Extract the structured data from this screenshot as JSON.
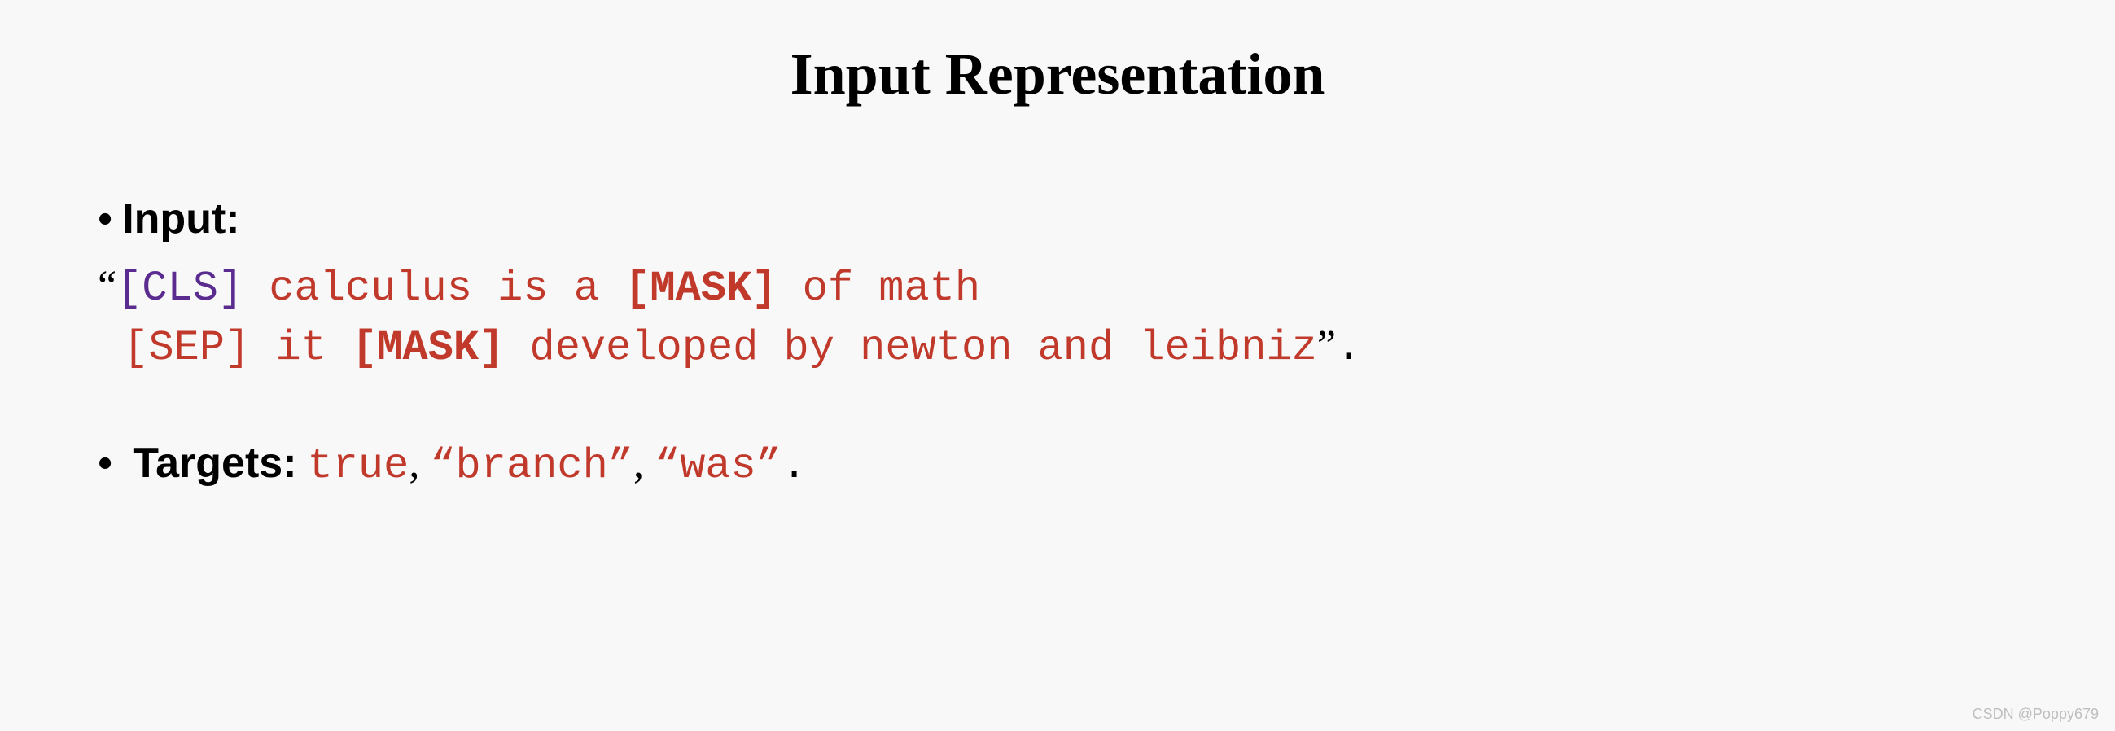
{
  "title": "Input Representation",
  "input": {
    "label": "Input:",
    "open_quote": "“",
    "cls": "[CLS]",
    "seg1a": " calculus is a ",
    "mask1": "[MASK]",
    "seg1b": " of math",
    "sep": " [SEP]",
    "seg2a": " it ",
    "mask2": "[MASK]",
    "seg2b": " developed by newton and leibniz",
    "close_quote": "”",
    "period": "."
  },
  "targets": {
    "label": "Targets:",
    "v1": "true",
    "c1": ", ",
    "v2": "“branch”",
    "c2": ", ",
    "v3": "“was”",
    "period": "."
  },
  "watermark": "CSDN @Poppy679"
}
